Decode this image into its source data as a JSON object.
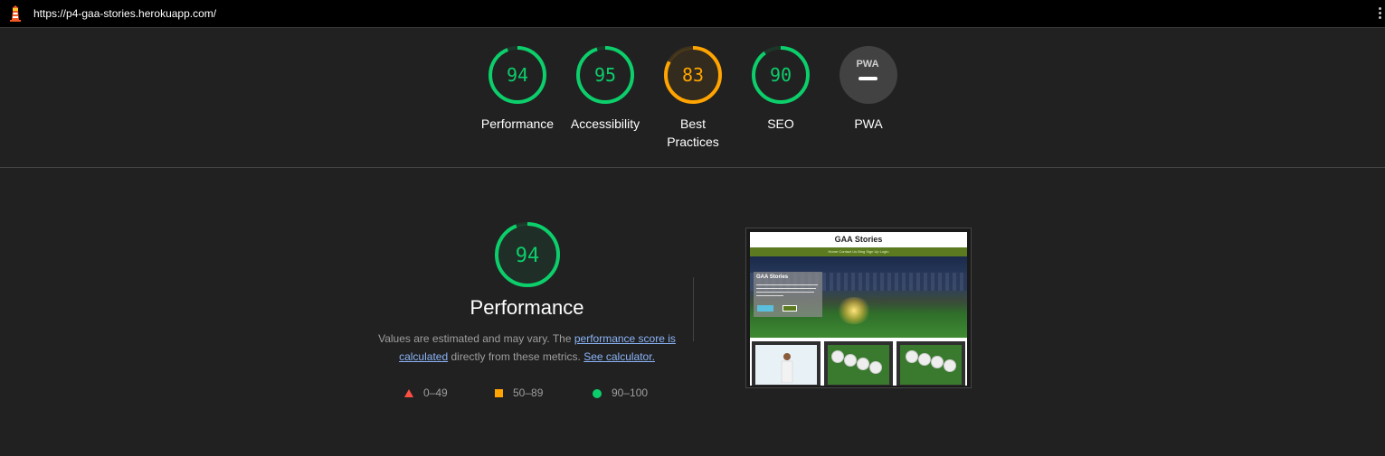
{
  "topbar": {
    "url": "https://p4-gaa-stories.herokuapp.com/",
    "logo_icon": "lighthouse-icon",
    "menu_icon": "kebab-menu-icon"
  },
  "colors": {
    "pass": "#0cce6b",
    "average": "#ffa400",
    "fail": "#ff4e42",
    "pwa_gray": "#424242",
    "link": "#8ab4f8"
  },
  "gauges": [
    {
      "score": "94",
      "label": "Performance",
      "score_value": 0.94,
      "status": "pass"
    },
    {
      "score": "95",
      "label": "Accessibility",
      "score_value": 0.95,
      "status": "pass"
    },
    {
      "score": "83",
      "label": "Best Practices",
      "score_value": 0.83,
      "status": "average"
    },
    {
      "score": "90",
      "label": "SEO",
      "score_value": 0.9,
      "status": "pass"
    },
    {
      "score": "",
      "label": "PWA",
      "badge": "PWA",
      "status": "na"
    }
  ],
  "performance": {
    "score": "94",
    "score_value": 0.94,
    "title": "Performance",
    "desc_prefix": "Values are estimated and may vary. The ",
    "link_score": "performance score is calculated",
    "desc_middle": " directly from these metrics. ",
    "link_calculator": "See calculator.",
    "legend": [
      {
        "range": "0–49",
        "shape": "triangle"
      },
      {
        "range": "50–89",
        "shape": "square"
      },
      {
        "range": "90–100",
        "shape": "circle"
      }
    ]
  },
  "screenshot": {
    "site_title": "GAA Stories",
    "nav": "Home  Contact Us  Blog  Sign Up  Login",
    "hero_title": "GAA Stories"
  }
}
